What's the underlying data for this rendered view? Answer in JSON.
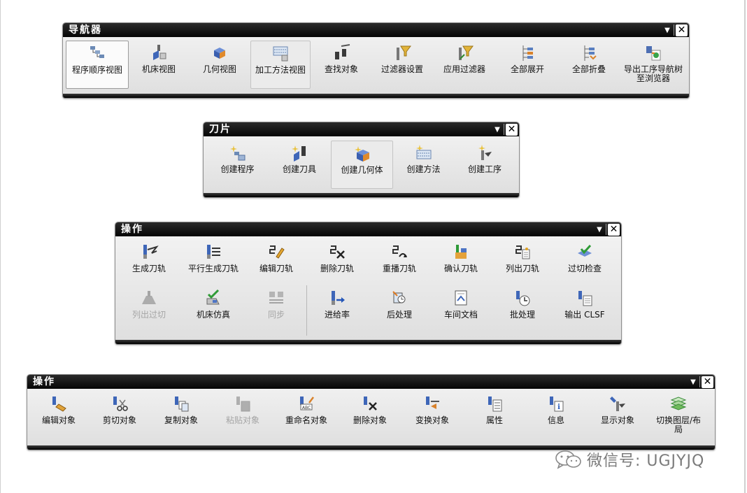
{
  "toolbars": {
    "navigator": {
      "title": "导航器",
      "buttons": [
        {
          "label": "程序顺序视图",
          "icon": "program-order-view-icon",
          "state": "pressed"
        },
        {
          "label": "机床视图",
          "icon": "machine-tool-view-icon"
        },
        {
          "label": "几何视图",
          "icon": "geometry-view-icon"
        },
        {
          "label": "加工方法视图",
          "icon": "machining-method-view-icon",
          "state": "hot"
        },
        {
          "label": "查找对象",
          "icon": "binoculars-icon"
        },
        {
          "label": "过滤器设置",
          "icon": "filter-settings-icon"
        },
        {
          "label": "应用过滤器",
          "icon": "apply-filter-icon"
        },
        {
          "label": "全部展开",
          "icon": "expand-all-icon"
        },
        {
          "label": "全部折叠",
          "icon": "collapse-all-icon"
        },
        {
          "label": "导出工序导航树至浏览器",
          "icon": "export-browser-icon"
        }
      ]
    },
    "inserts": {
      "title": "刀片",
      "buttons": [
        {
          "label": "创建程序",
          "icon": "create-program-icon"
        },
        {
          "label": "创建刀具",
          "icon": "create-tool-icon"
        },
        {
          "label": "创建几何体",
          "icon": "create-geometry-icon",
          "state": "hot"
        },
        {
          "label": "创建方法",
          "icon": "create-method-icon"
        },
        {
          "label": "创建工序",
          "icon": "create-operation-icon"
        }
      ]
    },
    "operations": {
      "title": "操作",
      "row1": [
        {
          "label": "生成刀轨",
          "icon": "generate-toolpath-icon"
        },
        {
          "label": "平行生成刀轨",
          "icon": "parallel-generate-icon"
        },
        {
          "label": "编辑刀轨",
          "icon": "edit-toolpath-icon"
        },
        {
          "label": "删除刀轨",
          "icon": "delete-toolpath-icon"
        },
        {
          "label": "重播刀轨",
          "icon": "replay-toolpath-icon"
        },
        {
          "label": "确认刀轨",
          "icon": "verify-toolpath-icon"
        },
        {
          "label": "列出刀轨",
          "icon": "list-toolpath-icon"
        },
        {
          "label": "过切检查",
          "icon": "gouge-check-icon"
        }
      ],
      "row2": [
        {
          "label": "列出过切",
          "icon": "list-gouges-icon",
          "state": "disabled"
        },
        {
          "label": "机床仿真",
          "icon": "machine-simulation-icon"
        },
        {
          "label": "同步",
          "icon": "synchronize-icon",
          "state": "disabled"
        },
        {
          "label": "进给率",
          "icon": "feed-rate-icon"
        },
        {
          "label": "后处理",
          "icon": "postprocess-icon"
        },
        {
          "label": "车间文档",
          "icon": "shop-document-icon"
        },
        {
          "label": "批处理",
          "icon": "batch-process-icon"
        },
        {
          "label": "输出 CLSF",
          "icon": "output-clsf-icon"
        }
      ]
    },
    "object_ops": {
      "title": "操作",
      "buttons": [
        {
          "label": "编辑对象",
          "icon": "edit-object-icon"
        },
        {
          "label": "剪切对象",
          "icon": "cut-object-icon"
        },
        {
          "label": "复制对象",
          "icon": "copy-object-icon"
        },
        {
          "label": "粘贴对象",
          "icon": "paste-object-icon",
          "state": "disabled"
        },
        {
          "label": "重命名对象",
          "icon": "rename-object-icon"
        },
        {
          "label": "删除对象",
          "icon": "delete-object-icon"
        },
        {
          "label": "变换对象",
          "icon": "transform-object-icon"
        },
        {
          "label": "属性",
          "icon": "properties-icon"
        },
        {
          "label": "信息",
          "icon": "information-icon"
        },
        {
          "label": "显示对象",
          "icon": "display-object-icon"
        },
        {
          "label": "切换图层/布局",
          "icon": "switch-layer-layout-icon"
        }
      ]
    }
  },
  "watermark": "微信号: UGJYJQ",
  "colors": {
    "titlebar": "#111111",
    "toolbar_bg": "#e6e6e6",
    "disabled_text": "#a5a5a5"
  }
}
